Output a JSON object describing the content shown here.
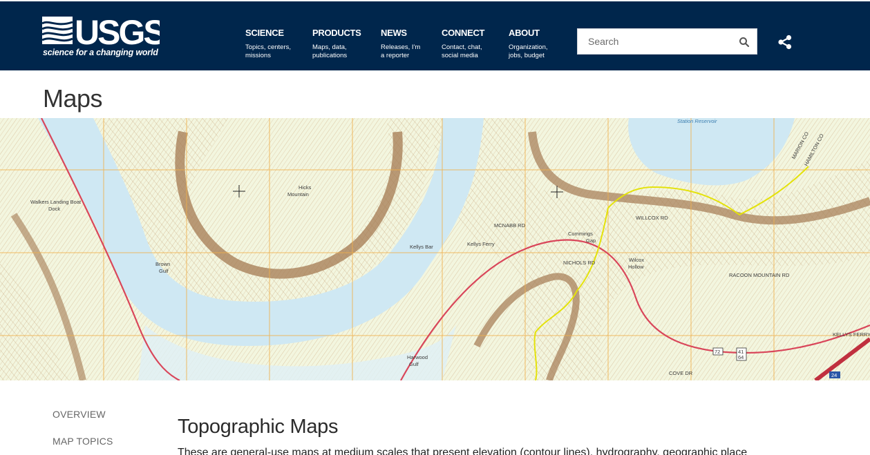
{
  "header": {
    "logo_text": "USGS",
    "tagline": "science for a changing world",
    "nav": [
      {
        "title": "SCIENCE",
        "sub": "Topics, centers, missions"
      },
      {
        "title": "PRODUCTS",
        "sub": "Maps, data, publications"
      },
      {
        "title": "NEWS",
        "sub": "Releases, I'm a reporter"
      },
      {
        "title": "CONNECT",
        "sub": "Contact, chat, social media"
      },
      {
        "title": "ABOUT",
        "sub": "Organization, jobs, budget"
      }
    ],
    "search": {
      "placeholder": "Search"
    },
    "icons": {
      "search": "magnifier-icon",
      "share": "share-icon"
    }
  },
  "page": {
    "title": "Maps"
  },
  "map_labels": {
    "reservoir": "Station Reservoir",
    "hicks_1": "Hicks",
    "hicks_2": "Mountain",
    "walkers": "Walkers Landing Boat",
    "walkers_2": "Dock",
    "brown_1": "Brown",
    "brown_2": "Gulf",
    "kellys_bar": "Kellys Bar",
    "kellys_ferry": "Kellys Ferry",
    "cummings_1": "Cummings",
    "cummings_2": "Gap",
    "wilcox_1": "Wilcox",
    "wilcox_2": "Hollow",
    "harwood_1": "Harwood",
    "harwood_2": "Gulf",
    "marion": "MARION CO",
    "hamilton": "HAMILTON CO",
    "racoon": "RACOON MOUNTAIN RD",
    "kellys_ferry_rd": "KELLYS FERRY RD",
    "willcox_rd": "WILLCOX RD",
    "mcnabb_rd": "MCNABB RD",
    "nichols_rd": "NICHOLS RD",
    "cove_dr": "COVE DR",
    "route_72": "72",
    "route_41": "41",
    "route_64": "64",
    "route_24": "24"
  },
  "sidebar": {
    "items": [
      "OVERVIEW",
      "MAP TOPICS"
    ]
  },
  "content": {
    "title": "Topographic Maps",
    "text": "These are general-use maps at medium scales that present elevation (contour lines), hydrography, geographic place"
  },
  "colors": {
    "header_bg": "#00264c",
    "water": "#cfe8f3",
    "land": "#f3f7e2",
    "contour": "#b8946a",
    "grid": "#f0b04a",
    "road": "#d9465a"
  }
}
